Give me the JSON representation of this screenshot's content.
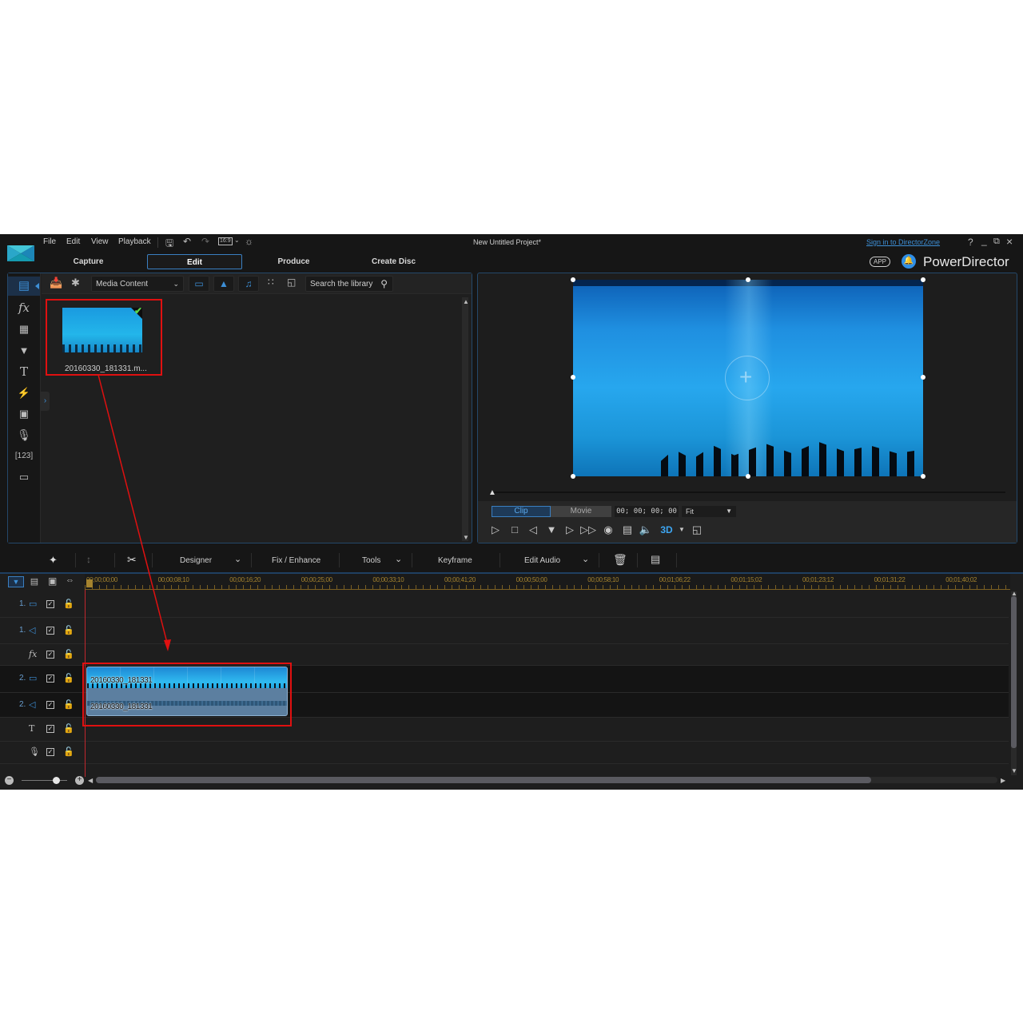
{
  "app": {
    "name": "PowerDirector",
    "window_title": "New Untitled Project*",
    "sign_in_link": "Sign in to DirectorZone",
    "app_badge": "APP",
    "window_controls": [
      "?",
      "_",
      "restore",
      "×"
    ],
    "menu": [
      "File",
      "Edit",
      "View",
      "Playback"
    ],
    "aspect_ratio": "16:9",
    "accent_color": "#3a7fc1",
    "brand_blue": "#2f8ee6"
  },
  "mode_tabs": [
    {
      "label": "Capture",
      "active": false
    },
    {
      "label": "Edit",
      "active": true
    },
    {
      "label": "Produce",
      "active": false
    },
    {
      "label": "Create Disc",
      "active": false
    }
  ],
  "library": {
    "rail_icons": [
      "media-room-icon",
      "fx-icon",
      "pip-objects-icon",
      "particle-icon",
      "title-icon",
      "transition-icon",
      "audio-mixing-icon",
      "voice-over-icon",
      "chapter-icon",
      "subtitle-icon"
    ],
    "content_dropdown": "Media Content",
    "search_placeholder": "Search the library",
    "filters": [
      "video-filter",
      "image-filter",
      "audio-filter"
    ],
    "items": [
      {
        "name": "20160330_181331.m...",
        "in_use": true
      }
    ]
  },
  "preview": {
    "mode_buttons": [
      {
        "label": "Clip",
        "active": true
      },
      {
        "label": "Movie",
        "active": false
      }
    ],
    "timecode": "00; 00; 00; 00",
    "zoom_select": "Fit",
    "three_d_label": "3D",
    "controls": [
      "play",
      "stop",
      "previous-frame",
      "split",
      "next-frame",
      "fast-forward",
      "snapshot",
      "subtitle",
      "volume",
      "3d",
      "undock"
    ]
  },
  "timeline_toolbar": {
    "designer": "Designer",
    "fix_enhance": "Fix / Enhance",
    "tools": "Tools",
    "keyframe": "Keyframe",
    "edit_audio": "Edit Audio"
  },
  "ruler": {
    "labels": [
      "00;00;00;00",
      "00;00;08;10",
      "00;00;16;20",
      "00;00;25;00",
      "00;00;33;10",
      "00;00;41;20",
      "00;00;50;00",
      "00;00;58;10",
      "00;01;06;22",
      "00;01;15;02",
      "00;01;23;12",
      "00;01;31;22",
      "00;01;40;02"
    ]
  },
  "tracks": [
    {
      "num": "1.",
      "type": "video",
      "enabled": true
    },
    {
      "num": "1.",
      "type": "audio",
      "enabled": true
    },
    {
      "num": "",
      "type": "fx",
      "enabled": true
    },
    {
      "num": "2.",
      "type": "video",
      "enabled": true
    },
    {
      "num": "2.",
      "type": "audio",
      "enabled": true
    },
    {
      "num": "",
      "type": "title",
      "enabled": true
    },
    {
      "num": "",
      "type": "voice",
      "enabled": true
    }
  ],
  "clips": {
    "video_clip_label": "20160330_181331",
    "audio_clip_label": "20160330_181331"
  },
  "timeline_zoom": {
    "slider_position": 0.75
  },
  "timeline_hscroll": {
    "thumb_fraction": 0.86
  }
}
